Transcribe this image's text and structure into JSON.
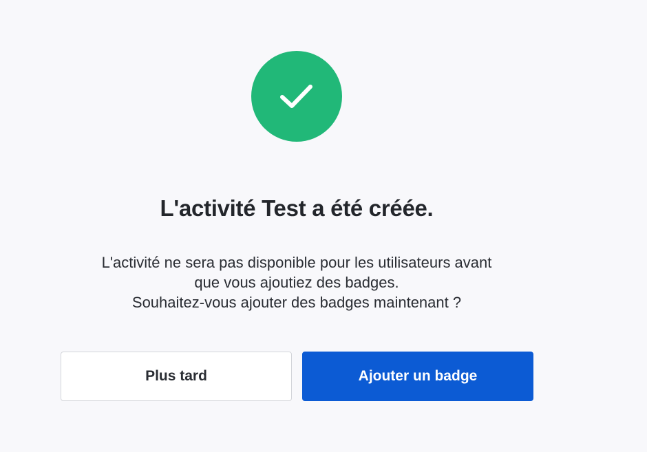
{
  "status": {
    "icon": "check-icon",
    "color": "#21b878"
  },
  "title": "L'activité Test a été créée.",
  "message": {
    "line1": "L'activité ne sera pas disponible pour les utilisateurs avant",
    "line2": "que vous ajoutiez des badges.",
    "line3": "Souhaitez-vous ajouter des badges maintenant ?"
  },
  "actions": {
    "later_label": "Plus tard",
    "add_badge_label": "Ajouter un badge",
    "primary_color": "#0c5bd4"
  }
}
